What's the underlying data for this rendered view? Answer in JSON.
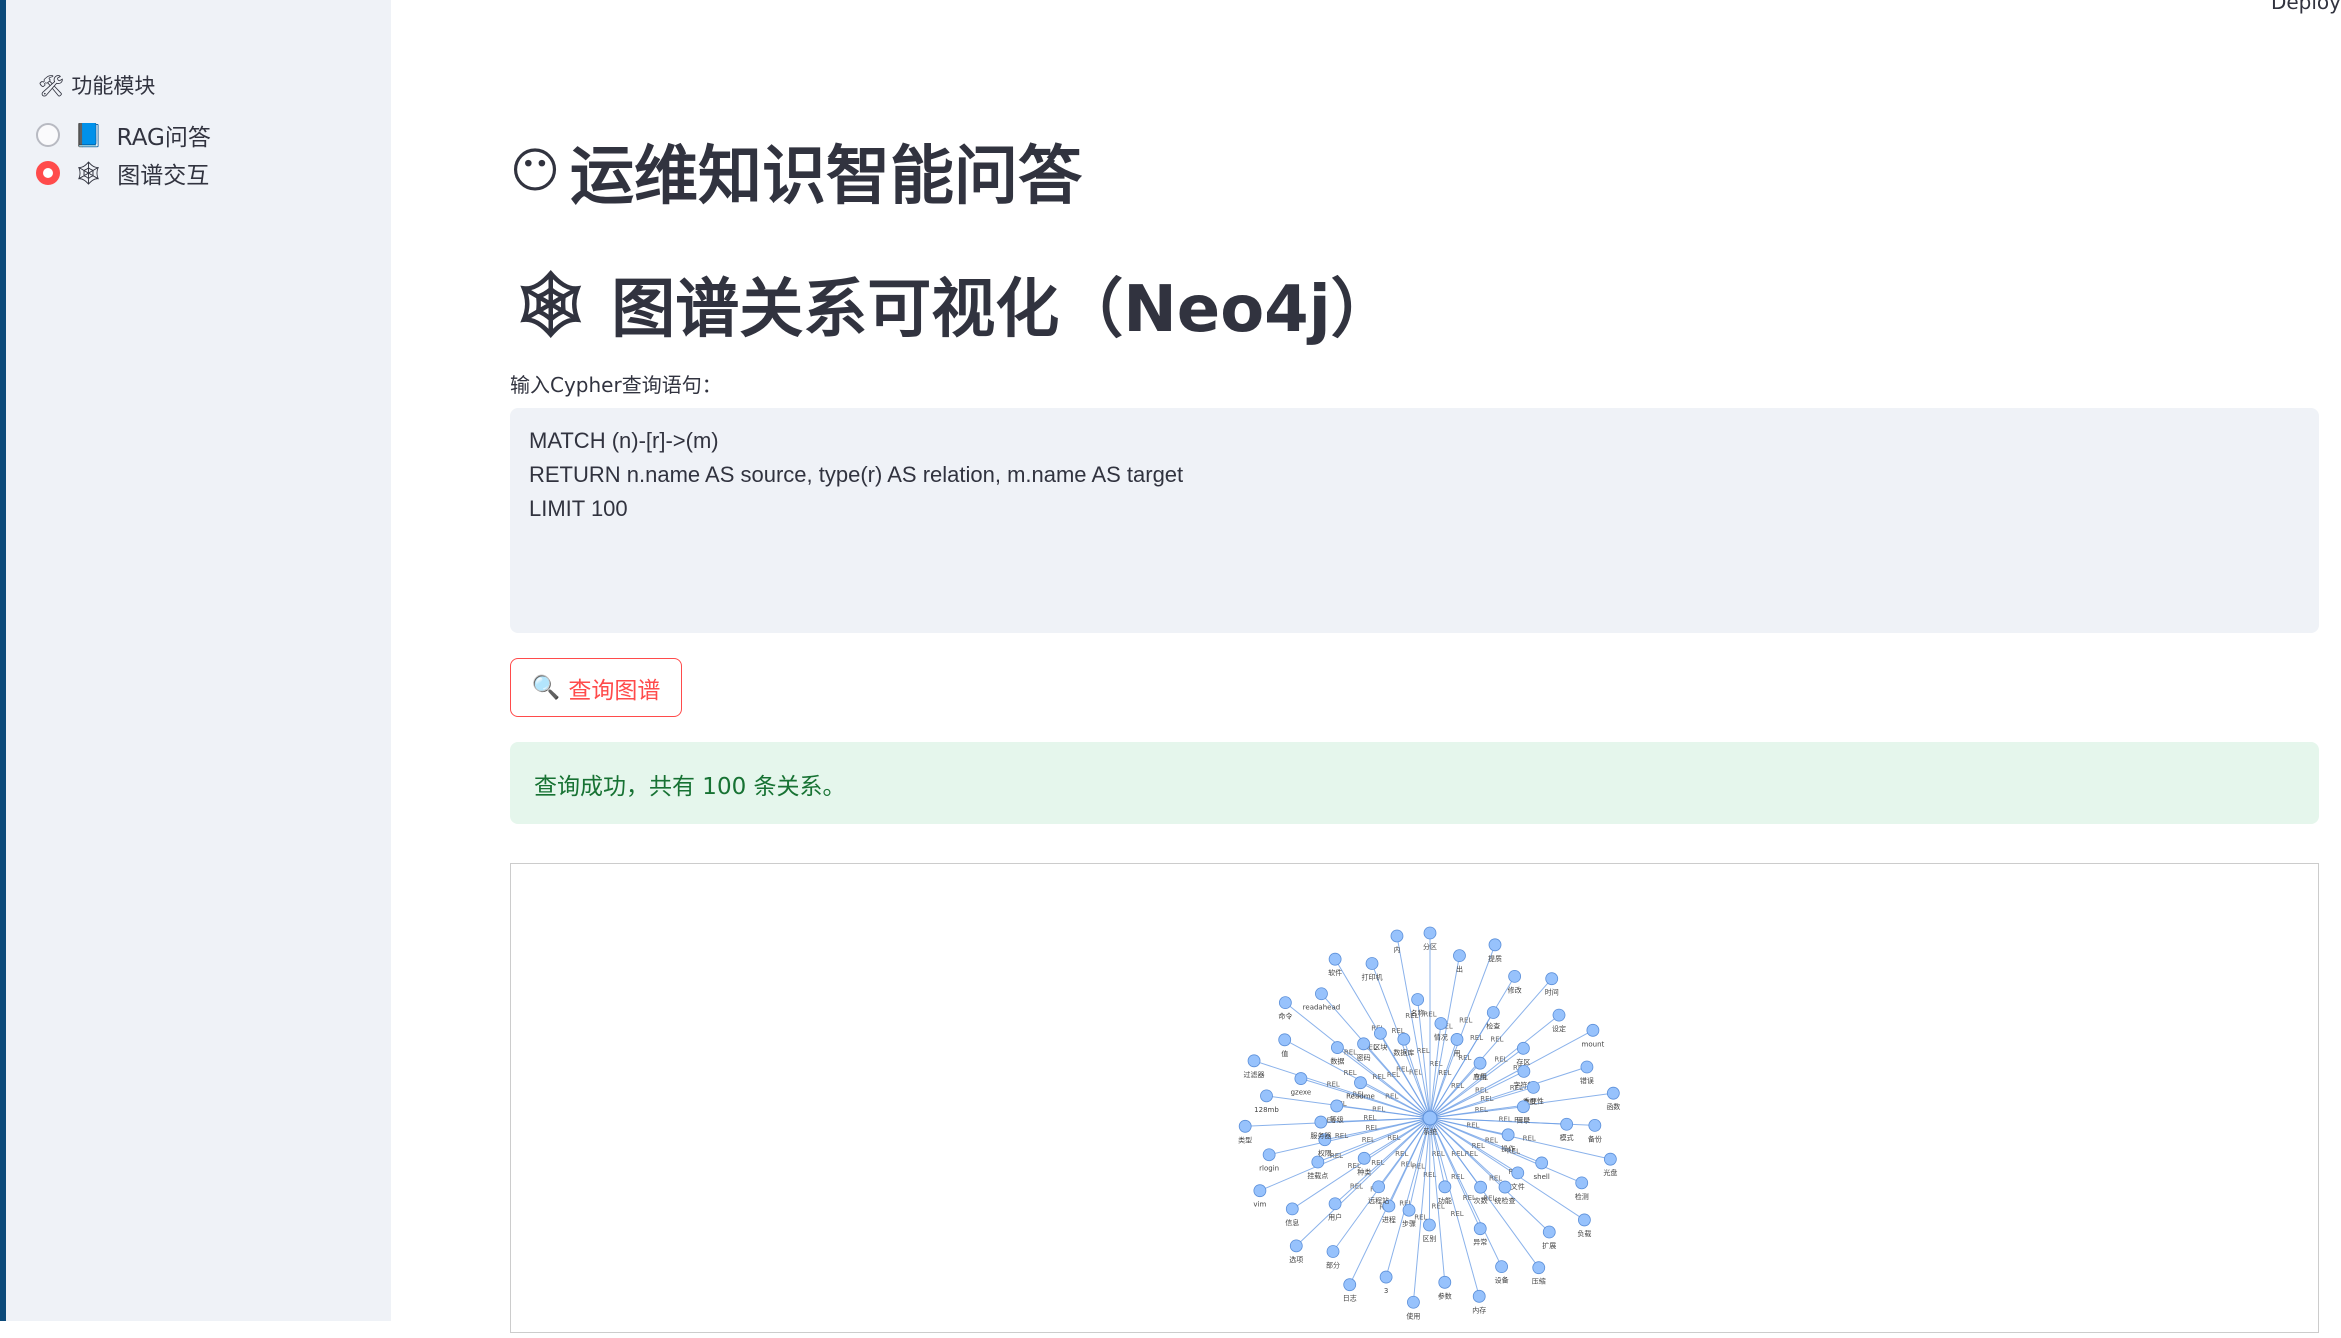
{
  "sidebar": {
    "title": "🛠 功能模块",
    "title_icon": "tools-icon",
    "options": [
      {
        "icon": "📘",
        "label": "RAG问答",
        "selected": false
      },
      {
        "icon": "🕸",
        "label": "图谱交互",
        "selected": true
      }
    ]
  },
  "header": {
    "deploy": "Deploy"
  },
  "main": {
    "title_icon": "😶",
    "title": "运维知识智能问答",
    "subtitle_icon": "🕸",
    "subtitle": "图谱关系可视化（Neo4j）",
    "query_label": "输入Cypher查询语句：",
    "query_value": "MATCH (n)-[r]->(m)\nRETURN n.name AS source, type(r) AS relation, m.name AS target\nLIMIT 100",
    "query_button": "查询图谱",
    "query_button_icon": "🔍",
    "success": "查询成功，共有 100 条关系。",
    "accent": "#ff4b4b"
  },
  "graph": {
    "center": "系统",
    "relation": "REL",
    "node_color": "#97c2fc",
    "edge_color": "#6e9fe6",
    "inner": [
      "情况",
      "用",
      "检查",
      "应用",
      "存区",
      "字符集",
      "重要性",
      "目录",
      "模式",
      "操作",
      "shell",
      "文件",
      "统检查",
      "次数",
      "异常",
      "功能",
      "区别",
      "步骤",
      "进程",
      "远程站",
      "用户",
      "种类",
      "挂载点",
      "权限",
      "服务器",
      "等级",
      "gzexe",
      "Readme",
      "数据",
      "密码",
      "区块",
      "数据库",
      "名称"
    ],
    "outer": [
      "分区",
      "出",
      "提质",
      "修改",
      "时间",
      "设定",
      "mount",
      "错误",
      "函数",
      "备份",
      "光盘",
      "检测",
      "负载",
      "扩展",
      "压缩",
      "设备",
      "内存",
      "参数",
      "使用",
      "3",
      "日志",
      "部分",
      "选项",
      "信息",
      "vim",
      "rlogin",
      "类型",
      "128mb",
      "过滤器",
      "值",
      "命令",
      "readahead",
      "软件",
      "打印机",
      "内"
    ]
  }
}
